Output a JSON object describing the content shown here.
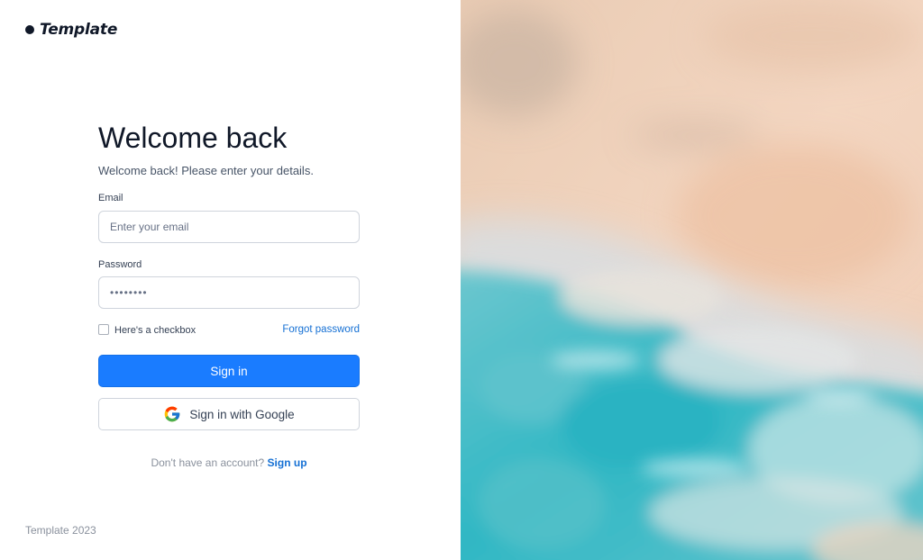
{
  "brand": {
    "name": "Template"
  },
  "login": {
    "title": "Welcome back",
    "subtitle": "Welcome back! Please enter your details.",
    "email_label": "Email",
    "email_placeholder": "Enter your email",
    "email_value": "",
    "password_label": "Password",
    "password_value": "••••••••",
    "checkbox_label": "Here's a checkbox",
    "checkbox_checked": false,
    "forgot_label": "Forgot password",
    "sign_in_label": "Sign in",
    "google_label": "Sign in with Google",
    "signup_prefix": "Don't have an account?",
    "signup_link": "Sign up"
  },
  "footer": {
    "text": "Template 2023"
  },
  "colors": {
    "primary": "#1a7cff",
    "link": "#1570d4",
    "text_dark": "#101828",
    "muted": "#8a919d",
    "sand": "#efd2bd",
    "sea": "#2fb7c4"
  },
  "icons": {
    "logo": "dot-icon",
    "google": "google-icon"
  }
}
